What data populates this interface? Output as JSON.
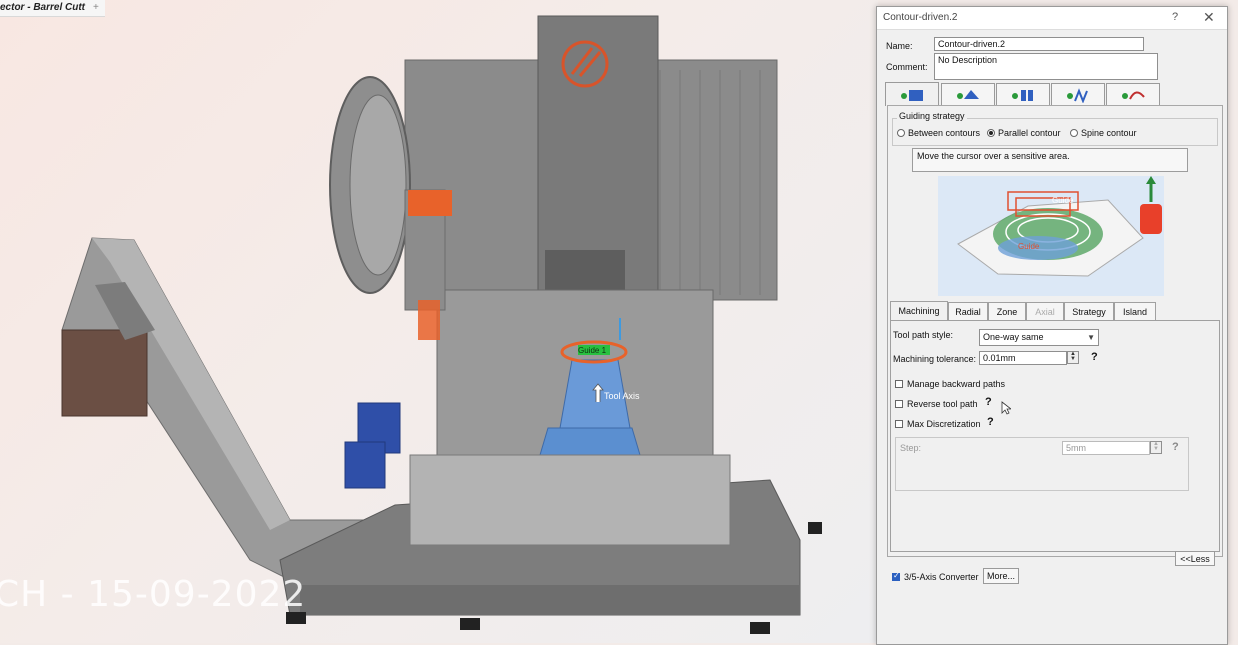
{
  "viewport": {
    "doc_tab_label": "ector - Barrel Cutt",
    "watermark": "CH - 15-09-2022",
    "callouts": {
      "guide": "Guide 1",
      "tool_axis": "Tool Axis"
    }
  },
  "dialog": {
    "title": "Contour-driven.2",
    "help_label": "?",
    "close_label": "✕",
    "name_label": "Name:",
    "name_value": "Contour-driven.2",
    "comment_label": "Comment:",
    "comment_value": "No Description",
    "icon_tabs": [
      "strategy-tab",
      "geometry-tab",
      "tool-tab",
      "feeds-speeds-tab",
      "macros-tab"
    ],
    "guiding": {
      "legend": "Guiding strategy",
      "options": [
        {
          "label": "Between contours",
          "selected": false
        },
        {
          "label": "Parallel contour",
          "selected": true
        },
        {
          "label": "Spine contour",
          "selected": false
        }
      ]
    },
    "hint": "Move the cursor over a sensitive area.",
    "preview_labels": {
      "guide": "Guide",
      "contour": "Guide"
    },
    "subtabs": [
      {
        "label": "Machining",
        "active": true,
        "disabled": false
      },
      {
        "label": "Radial",
        "active": false,
        "disabled": false
      },
      {
        "label": "Zone",
        "active": false,
        "disabled": false
      },
      {
        "label": "Axial",
        "active": false,
        "disabled": true
      },
      {
        "label": "Strategy",
        "active": false,
        "disabled": false
      },
      {
        "label": "Island",
        "active": false,
        "disabled": false
      }
    ],
    "machining": {
      "tool_path_style_label": "Tool path style:",
      "tool_path_style_value": "One-way same",
      "tolerance_label": "Machining tolerance:",
      "tolerance_value": "0.01mm",
      "manage_backward": {
        "label": "Manage backward paths",
        "checked": false
      },
      "reverse_tool_path": {
        "label": "Reverse tool path",
        "checked": false
      },
      "max_discretization": {
        "label": "Max Discretization",
        "checked": false
      },
      "step_label": "Step:",
      "step_value": "5mm",
      "q_mark": "?"
    },
    "less_button": "<<Less",
    "axis_converter": {
      "label": "3/5-Axis Converter",
      "checked": true
    },
    "more_button": "More..."
  },
  "colors": {
    "accent_orange": "#e8622a",
    "part_blue": "#5b8fd0",
    "machine_grey": "#8f8f8f",
    "dialog_bg": "#f0f0f0"
  }
}
